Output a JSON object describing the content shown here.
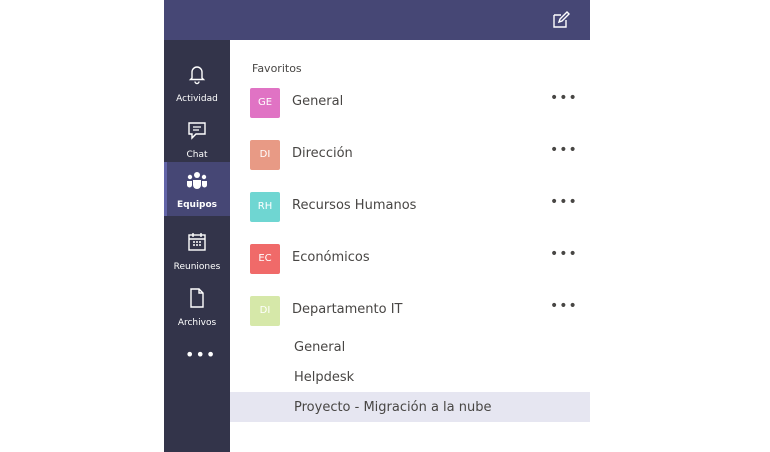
{
  "header": {
    "compose_icon": "compose-icon"
  },
  "rail": {
    "items": [
      {
        "label": "Actividad",
        "icon": "bell-icon"
      },
      {
        "label": "Chat",
        "icon": "chat-icon"
      },
      {
        "label": "Equipos",
        "icon": "teams-icon",
        "active": true
      },
      {
        "label": "Reuniones",
        "icon": "calendar-icon"
      },
      {
        "label": "Archivos",
        "icon": "file-icon"
      }
    ],
    "more": "•••"
  },
  "panel": {
    "section_title": "Favoritos",
    "teams": [
      {
        "initials": "GE",
        "name": "General",
        "color": "#e073c4"
      },
      {
        "initials": "DI",
        "name": "Dirección",
        "color": "#e89a85"
      },
      {
        "initials": "RH",
        "name": "Recursos Humanos",
        "color": "#6fd6d2"
      },
      {
        "initials": "EC",
        "name": "Económicos",
        "color": "#f06a69"
      },
      {
        "initials": "DI",
        "name": "Departamento IT",
        "color": "#d6e8a9"
      }
    ],
    "more_label": "•••",
    "channels": [
      {
        "name": "General"
      },
      {
        "name": "Helpdesk"
      },
      {
        "name": "Proyecto - Migración a la nube",
        "selected": true
      }
    ]
  }
}
